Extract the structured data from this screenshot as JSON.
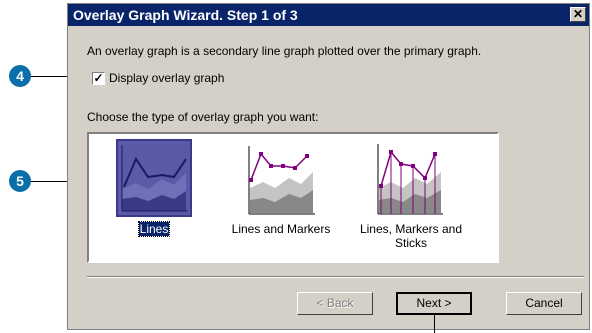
{
  "dialog": {
    "title": "Overlay Graph Wizard. Step 1 of 3",
    "close_glyph": "✕",
    "description": "An overlay graph is a secondary line graph plotted over the primary graph.",
    "checkbox_label": "Display overlay graph",
    "checkbox_checked": true,
    "choose_label": "Choose the type of overlay graph you want:",
    "options": [
      {
        "label": "Lines",
        "selected": true
      },
      {
        "label": "Lines and Markers",
        "selected": false
      },
      {
        "label_line1": "Lines, Markers and",
        "label_line2": "Sticks",
        "selected": false
      }
    ],
    "buttons": {
      "back": "< Back",
      "next": "Next >",
      "cancel": "Cancel"
    }
  },
  "callouts": [
    "4",
    "5"
  ]
}
